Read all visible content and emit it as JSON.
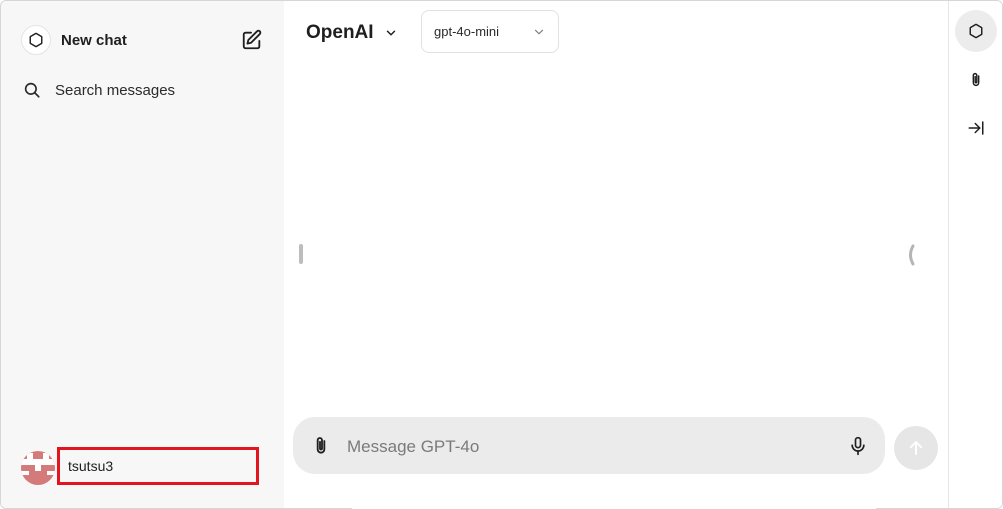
{
  "sidebar": {
    "new_chat_label": "New chat",
    "logo_icon": "openai-logo-icon",
    "edit_icon": "edit-icon",
    "search_label": "Search messages",
    "search_icon": "search-icon",
    "user": {
      "name": "tsutsu3",
      "avatar_color": "#d47a7a"
    }
  },
  "header": {
    "provider_label": "OpenAI",
    "model_selected": "gpt-4o-mini"
  },
  "composer": {
    "placeholder": "Message GPT-4o",
    "value": "",
    "attach_icon": "paperclip-icon",
    "mic_icon": "microphone-icon",
    "send_icon": "arrow-up-icon"
  },
  "right_rail": {
    "items": [
      {
        "icon": "openai-logo-icon",
        "active": true
      },
      {
        "icon": "paperclip-icon",
        "active": false
      },
      {
        "icon": "collapse-right-icon",
        "active": false
      }
    ]
  },
  "colors": {
    "sidebar_bg": "#f7f7f7",
    "composer_bg": "#ebebeb",
    "highlight_box": "#e2141f",
    "send_bg": "#e6e6e6"
  }
}
